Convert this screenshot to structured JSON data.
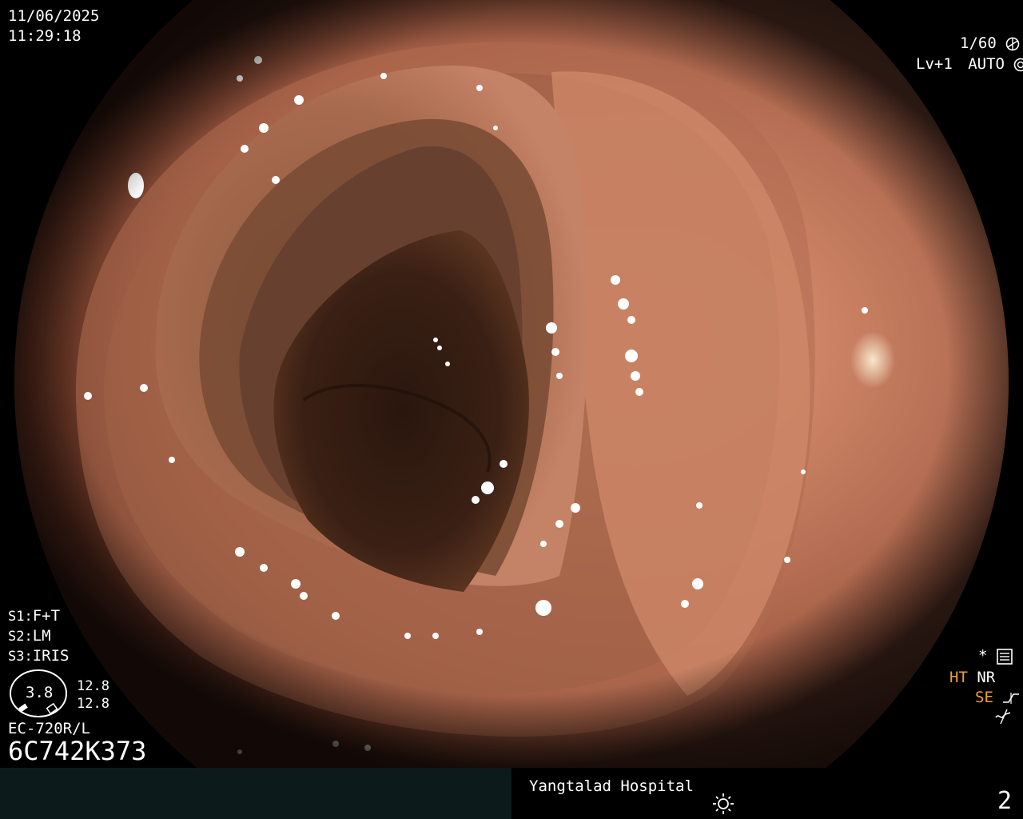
{
  "overlay": {
    "date": "11/06/2025",
    "time": "11:29:18",
    "shutter": "1/60",
    "level": "Lv+1",
    "exposure_mode": "AUTO",
    "settings": [
      {
        "key": "S1:",
        "value": "F+T"
      },
      {
        "key": "S2:",
        "value": "LM"
      },
      {
        "key": "S3:",
        "value": "IRIS"
      }
    ],
    "gauge_value": "3.8",
    "gauge_side_top": "12.8",
    "gauge_side_bottom": "12.8",
    "scope_model": "EC-720R/L",
    "serial": "6C742K373",
    "right_status": {
      "asterisk": "*",
      "ht": "HT",
      "nr": "NR",
      "se": "SE"
    }
  },
  "bottom_bar": {
    "hospital": "Yangtalad Hospital",
    "image_number": "2"
  },
  "icons": [
    "shutter-icon",
    "auto-iris-icon",
    "menu-settings-icon",
    "se-curve-icon",
    "noise-icon",
    "brightness-sun-icon",
    "gauge-icon"
  ]
}
